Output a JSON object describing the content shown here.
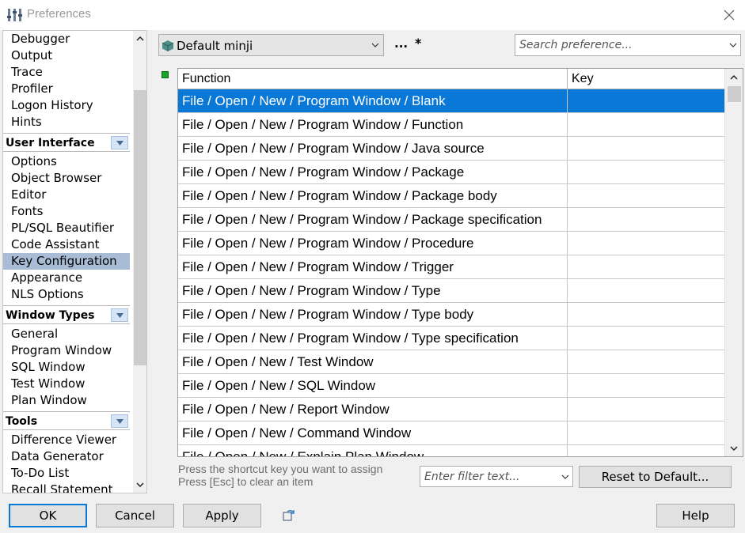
{
  "window": {
    "title": "Preferences"
  },
  "nav": {
    "items": [
      {
        "type": "item",
        "label": "Debugger"
      },
      {
        "type": "item",
        "label": "Output"
      },
      {
        "type": "item",
        "label": "Trace"
      },
      {
        "type": "item",
        "label": "Profiler"
      },
      {
        "type": "item",
        "label": "Logon History"
      },
      {
        "type": "item",
        "label": "Hints"
      },
      {
        "type": "group",
        "label": "User Interface"
      },
      {
        "type": "item",
        "label": "Options"
      },
      {
        "type": "item",
        "label": "Object Browser"
      },
      {
        "type": "item",
        "label": "Editor"
      },
      {
        "type": "item",
        "label": "Fonts"
      },
      {
        "type": "item",
        "label": "PL/SQL Beautifier"
      },
      {
        "type": "item",
        "label": "Code Assistant"
      },
      {
        "type": "item",
        "label": "Key Configuration",
        "selected": true
      },
      {
        "type": "item",
        "label": "Appearance"
      },
      {
        "type": "item",
        "label": "NLS Options"
      },
      {
        "type": "group",
        "label": "Window Types"
      },
      {
        "type": "item",
        "label": "General"
      },
      {
        "type": "item",
        "label": "Program Window"
      },
      {
        "type": "item",
        "label": "SQL Window"
      },
      {
        "type": "item",
        "label": "Test Window"
      },
      {
        "type": "item",
        "label": "Plan Window"
      },
      {
        "type": "group",
        "label": "Tools"
      },
      {
        "type": "item",
        "label": "Difference Viewer"
      },
      {
        "type": "item",
        "label": "Data Generator"
      },
      {
        "type": "item",
        "label": "To-Do List"
      },
      {
        "type": "item",
        "label": "Recall Statement"
      }
    ]
  },
  "toolbar": {
    "profile": "Default minji",
    "ellipsis": "...",
    "modified_marker": "*",
    "search_placeholder": "Search preference..."
  },
  "table": {
    "columns": [
      "Function",
      "Key"
    ],
    "rows": [
      {
        "function": "File / Open / New / Program Window / Blank",
        "key": "",
        "selected": true
      },
      {
        "function": "File / Open / New / Program Window / Function",
        "key": ""
      },
      {
        "function": "File / Open / New / Program Window / Java source",
        "key": ""
      },
      {
        "function": "File / Open / New / Program Window / Package",
        "key": ""
      },
      {
        "function": "File / Open / New / Program Window / Package body",
        "key": ""
      },
      {
        "function": "File / Open / New / Program Window / Package specification",
        "key": ""
      },
      {
        "function": "File / Open / New / Program Window / Procedure",
        "key": ""
      },
      {
        "function": "File / Open / New / Program Window / Trigger",
        "key": ""
      },
      {
        "function": "File / Open / New / Program Window / Type",
        "key": ""
      },
      {
        "function": "File / Open / New / Program Window / Type body",
        "key": ""
      },
      {
        "function": "File / Open / New / Program Window / Type specification",
        "key": ""
      },
      {
        "function": "File / Open / New / Test Window",
        "key": ""
      },
      {
        "function": "File / Open / New / SQL Window",
        "key": ""
      },
      {
        "function": "File / Open / New / Report Window",
        "key": ""
      },
      {
        "function": "File / Open / New / Command Window",
        "key": ""
      },
      {
        "function": "File / Open / New / Explain Plan Window",
        "key": ""
      }
    ]
  },
  "hint": {
    "line1": "Press the shortcut key you want to assign",
    "line2": "Press [Esc] to clear an item"
  },
  "filter": {
    "placeholder": "Enter filter text..."
  },
  "buttons": {
    "reset": "Reset to Default...",
    "ok": "OK",
    "cancel": "Cancel",
    "apply": "Apply",
    "help": "Help"
  },
  "colors": {
    "selection": "#0a78d7",
    "nav_selection": "#a8bcd6",
    "modified_indicator": "#19a52a"
  }
}
